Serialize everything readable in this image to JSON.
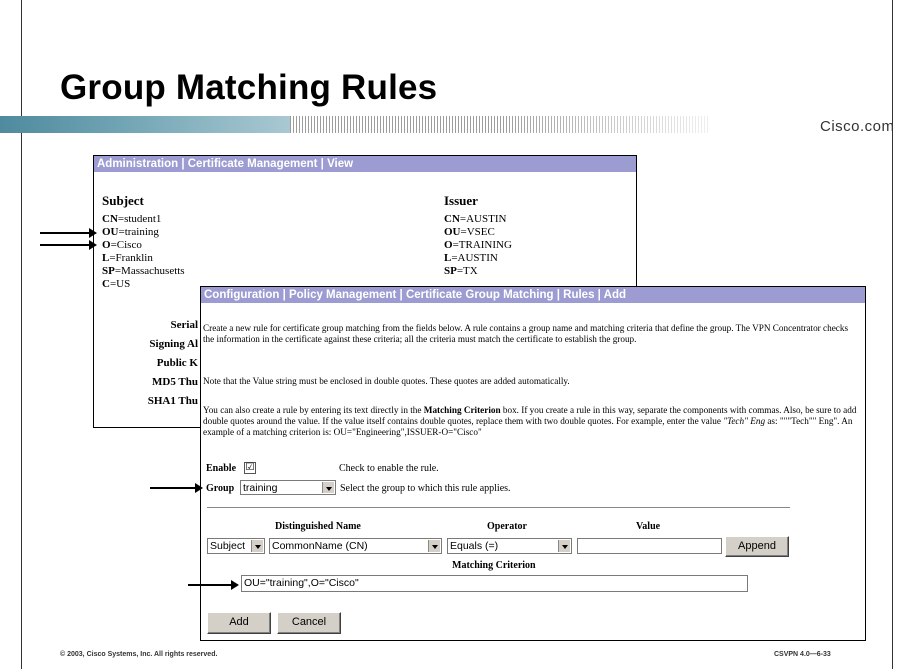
{
  "slide": {
    "title": "Group Matching Rules",
    "logo": "Cisco.com",
    "copyright": "© 2003, Cisco Systems, Inc. All rights reserved.",
    "course_id": "CSVPN 4.0—6-33"
  },
  "back_panel": {
    "header": "Administration | Certificate Management | View",
    "subject_heading": "Subject",
    "issuer_heading": "Issuer",
    "subject": [
      {
        "key": "CN",
        "value": "=student1"
      },
      {
        "key": "OU",
        "value": "=training"
      },
      {
        "key": "O",
        "value": "=Cisco"
      },
      {
        "key": "L",
        "value": "=Franklin"
      },
      {
        "key": "SP",
        "value": "=Massachusetts"
      },
      {
        "key": "C",
        "value": "=US"
      }
    ],
    "issuer": [
      {
        "key": "CN",
        "value": "=AUSTIN"
      },
      {
        "key": "OU",
        "value": "=VSEC"
      },
      {
        "key": "O",
        "value": "=TRAINING"
      },
      {
        "key": "L",
        "value": "=AUSTIN"
      },
      {
        "key": "SP",
        "value": "=TX"
      }
    ],
    "properties": [
      "Serial",
      "Signing Al",
      "Public K",
      "MD5 Thu",
      "SHA1 Thu"
    ]
  },
  "front_panel": {
    "header": "Configuration | Policy Management | Certificate Group Matching | Rules | Add",
    "intro_text": "Create a new rule for certificate group matching from the fields below. A rule contains a group name and matching criteria that define the group. The VPN Concentrator checks the information in the certificate against these criteria; all the criteria must match the certificate to establish the group.",
    "note_text": "Note that the Value string must be enclosed in double quotes. These quotes are added automatically.",
    "text_part1": "You can also create a rule by entering its text directly in the ",
    "text_bold": "Matching Criterion",
    "text_part2": " box. If you create a rule in this way, separate the components with commas. Also, be sure to add double quotes around the value. If the value itself contains double quotes, replace them with two double quotes. For example, enter the value ",
    "text_italic": "\"Tech\" Eng",
    "text_part3": " as: \"\"\"Tech\"\" Eng\". An example of a matching criterion is: OU=\"Engineering\",ISSUER-O=\"Cisco\"",
    "enable_label": "Enable",
    "enable_checked": "☑",
    "enable_help": "Check to enable the rule.",
    "group_label": "Group",
    "group_value": "training",
    "group_help": "Select the group to which this rule applies.",
    "col_dn": "Distinguished Name",
    "col_operator": "Operator",
    "col_value": "Value",
    "dn_type": "Subject",
    "dn_attr": "CommonName (CN)",
    "operator": "Equals (=)",
    "value": "",
    "append_button": "Append",
    "criterion_label": "Matching Criterion",
    "criterion_value": "OU=\"training\",O=\"Cisco\"",
    "add_button": "Add",
    "cancel_button": "Cancel"
  }
}
